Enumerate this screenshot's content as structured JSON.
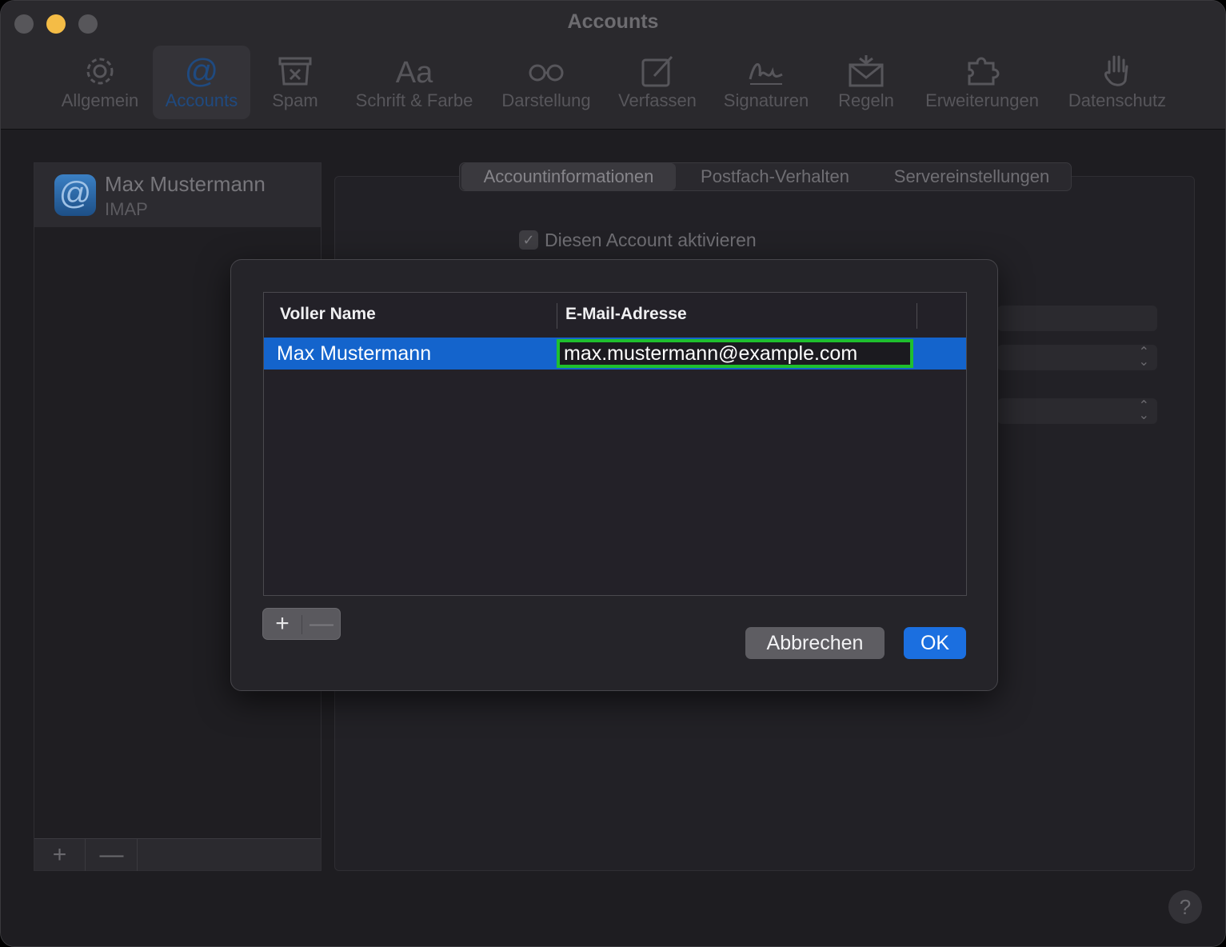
{
  "window": {
    "title": "Accounts"
  },
  "toolbar": {
    "items": [
      {
        "label": "Allgemein",
        "icon": "gear-icon"
      },
      {
        "label": "Accounts",
        "icon": "at-icon"
      },
      {
        "label": "Spam",
        "icon": "junk-bin-icon"
      },
      {
        "label": "Schrift & Farbe",
        "icon": "font-icon"
      },
      {
        "label": "Darstellung",
        "icon": "glasses-icon"
      },
      {
        "label": "Verfassen",
        "icon": "compose-icon"
      },
      {
        "label": "Signaturen",
        "icon": "signature-icon"
      },
      {
        "label": "Regeln",
        "icon": "rules-envelope-icon"
      },
      {
        "label": "Erweiterungen",
        "icon": "puzzle-icon"
      },
      {
        "label": "Datenschutz",
        "icon": "hand-icon"
      }
    ],
    "active": "Accounts"
  },
  "accounts": {
    "items": [
      {
        "name": "Max Mustermann",
        "type": "IMAP",
        "icon_glyph": "@"
      }
    ],
    "add_label": "+",
    "remove_label": "—"
  },
  "tabs": {
    "items": [
      "Accountinformationen",
      "Postfach-Verhalten",
      "Servereinstellungen"
    ],
    "selected": "Accountinformationen"
  },
  "account_info": {
    "enable_label": "Diesen Account aktivieren",
    "enabled": true,
    "checkmark": "✓"
  },
  "dialog": {
    "columns": [
      "Voller Name",
      "E-Mail-Adresse"
    ],
    "rows": [
      {
        "name": "Max Mustermann",
        "email": "max.mustermann@example.com"
      }
    ],
    "add_label": "+",
    "remove_label": "—",
    "cancel_label": "Abbrechen",
    "ok_label": "OK"
  },
  "help_label": "?",
  "colors": {
    "selection": "#1464cc",
    "focus_ring": "#1fbf2e",
    "ok_button": "#1b6fe0"
  }
}
